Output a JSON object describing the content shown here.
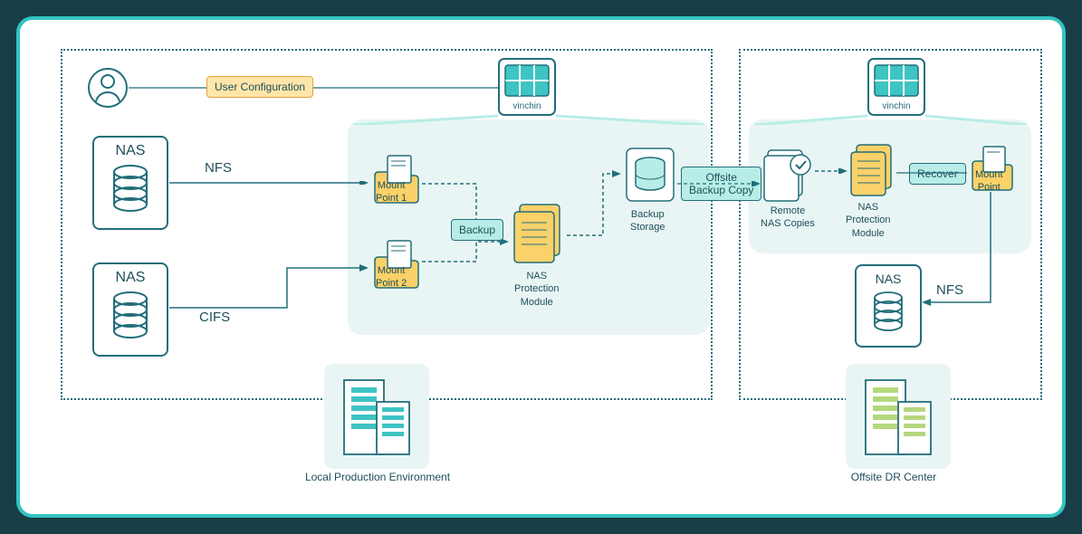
{
  "zones": {
    "local": {
      "title": "Local Production Environment"
    },
    "offsite": {
      "title": "Offsite DR Center"
    }
  },
  "user_config": {
    "label": "User Configuration"
  },
  "vinchin": {
    "label": "vinchin"
  },
  "nas": {
    "nas1": {
      "title": "NAS",
      "protocol": "NFS"
    },
    "nas2": {
      "title": "NAS",
      "protocol": "CIFS"
    },
    "nas3": {
      "title": "NAS",
      "protocol": "NFS"
    }
  },
  "mounts": {
    "m1": "Mount\nPoint 1",
    "m2": "Mount\nPoint 2",
    "m3": "Mount\nPoint"
  },
  "protection_module": {
    "local": "NAS\nProtection\nModule",
    "offsite": "NAS\nProtection\nModule"
  },
  "backup_storage": "Backup\nStorage",
  "remote_copies": "Remote\nNAS Copies",
  "flow_labels": {
    "backup": "Backup",
    "offsite_copy": "Offsite\nBackup Copy",
    "recover": "Recover"
  }
}
